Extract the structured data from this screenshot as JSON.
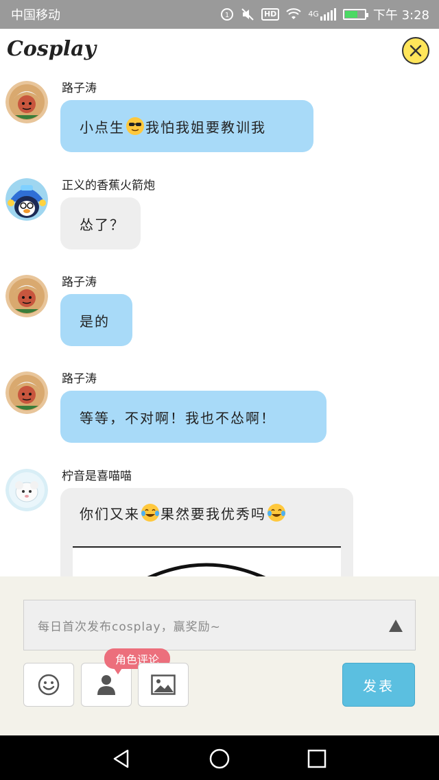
{
  "status_bar": {
    "carrier": "中国移动",
    "network": "4G",
    "hd": "HD",
    "time": "下午 3:28",
    "battery_level": 0.6
  },
  "header": {
    "title": "Cosplay",
    "close_icon": "close-icon"
  },
  "messages": [
    {
      "sender": "路子涛",
      "avatar": "avatar-white-hair-boy",
      "bubble_color": "#a8daf8",
      "parts": [
        "小点生",
        "[sunglasses-emoji]",
        "我怕我姐要教训我"
      ]
    },
    {
      "sender": "正义的香蕉火箭炮",
      "avatar": "avatar-blue-helmet-penguin",
      "bubble_color": "#eeeeee",
      "parts": [
        "怂了？"
      ]
    },
    {
      "sender": "路子涛",
      "avatar": "avatar-white-hair-boy",
      "bubble_color": "#a8daf8",
      "parts": [
        "是的"
      ]
    },
    {
      "sender": "路子涛",
      "avatar": "avatar-white-hair-boy",
      "bubble_color": "#a8daf8",
      "parts": [
        "等等，不对啊！我也不怂啊！"
      ]
    },
    {
      "sender": "柠音是喜喵喵",
      "avatar": "avatar-white-sheep",
      "bubble_color": "#eeeeee",
      "parts": [
        "你们又来",
        "[tears-of-joy-emoji]",
        "果然要我优秀吗",
        "[tears-of-joy-emoji]"
      ]
    }
  ],
  "composer": {
    "placeholder": "每日首次发布cosplay，赢奖励~",
    "role_comment_tag": "角色评论",
    "send_label": "发表",
    "tools": [
      "smiley-icon",
      "person-icon",
      "image-icon"
    ]
  },
  "nav": [
    "back-icon",
    "home-icon",
    "recents-icon"
  ]
}
